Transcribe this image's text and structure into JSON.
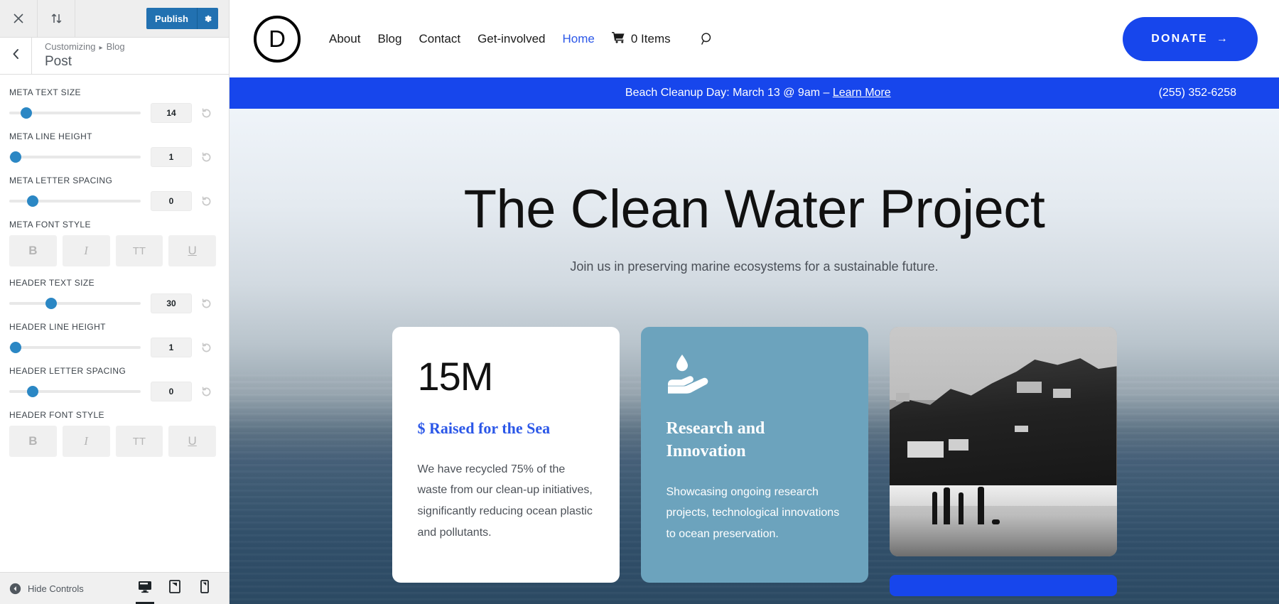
{
  "customizer": {
    "topbar": {
      "close_icon": "close-icon",
      "reorder_icon": "sort-updown-icon",
      "publish_label": "Publish",
      "gear_icon": "gear-icon"
    },
    "back_icon": "chevron-left-icon",
    "breadcrumb_root": "Customizing",
    "breadcrumb_sep": "▸",
    "breadcrumb_section": "Blog",
    "panel_title": "Post",
    "controls": [
      {
        "label": "META TEXT SIZE",
        "value": "14",
        "handle_pct": 13,
        "reset_icon": "reset-icon"
      },
      {
        "label": "META LINE HEIGHT",
        "value": "1",
        "handle_pct": 5,
        "reset_icon": "reset-icon"
      },
      {
        "label": "META LETTER SPACING",
        "value": "0",
        "handle_pct": 18,
        "reset_icon": "reset-icon"
      },
      {
        "label": "HEADER TEXT SIZE",
        "value": "30",
        "handle_pct": 32,
        "reset_icon": "reset-icon"
      },
      {
        "label": "HEADER LINE HEIGHT",
        "value": "1",
        "handle_pct": 5,
        "reset_icon": "reset-icon"
      },
      {
        "label": "HEADER LETTER SPACING",
        "value": "0",
        "handle_pct": 18,
        "reset_icon": "reset-icon"
      }
    ],
    "meta_font_style": {
      "label": "META FONT STYLE",
      "buttons": [
        "B",
        "I",
        "TT",
        "U"
      ]
    },
    "header_font_style": {
      "label": "HEADER FONT STYLE",
      "buttons": [
        "B",
        "I",
        "TT",
        "U"
      ]
    },
    "footer": {
      "hide_controls_label": "Hide Controls",
      "hide_icon": "collapse-left-icon",
      "devices": [
        {
          "name": "desktop-preview",
          "icon": "desktop-icon",
          "active": true
        },
        {
          "name": "tablet-preview",
          "icon": "tablet-icon",
          "active": false
        },
        {
          "name": "mobile-preview",
          "icon": "mobile-icon",
          "active": false
        }
      ]
    }
  },
  "site": {
    "logo_letter": "D",
    "nav": [
      {
        "label": "About",
        "current": false
      },
      {
        "label": "Blog",
        "current": false
      },
      {
        "label": "Contact",
        "current": false
      },
      {
        "label": "Get-involved",
        "current": false
      },
      {
        "label": "Home",
        "current": true
      }
    ],
    "cart": {
      "icon": "cart-icon",
      "label": "0 Items"
    },
    "search_icon": "search-icon",
    "donate": {
      "label": "DONATE",
      "arrow": "→"
    },
    "announcement": {
      "text": "Beach Cleanup Day: March 13 @ 9am – ",
      "link_label": "Learn More",
      "phone": "(255) 352-6258"
    },
    "hero": {
      "title": "The Clean Water Project",
      "subtitle": "Join us in preserving marine ecosystems for a sustainable future."
    },
    "cards": [
      {
        "type": "stat",
        "stat": "15M",
        "stat_label": "$ Raised for the Sea",
        "text": "We have recycled 75% of the waste from our clean-up initiatives, significantly reducing ocean plastic and pollutants."
      },
      {
        "type": "feature",
        "icon": "water-drop-hand-icon",
        "title": "Research and Innovation",
        "text": "Showcasing ongoing research projects, technological innovations to ocean preservation."
      },
      {
        "type": "photo",
        "image_alt": "people-walking-on-beach-photo"
      }
    ],
    "colors": {
      "brand_blue": "#1746ec",
      "card_blue": "#6ca3bd",
      "link_blue": "#2b57e8",
      "publish_blue": "#2271b1",
      "slider_blue": "#2b87c4"
    }
  }
}
